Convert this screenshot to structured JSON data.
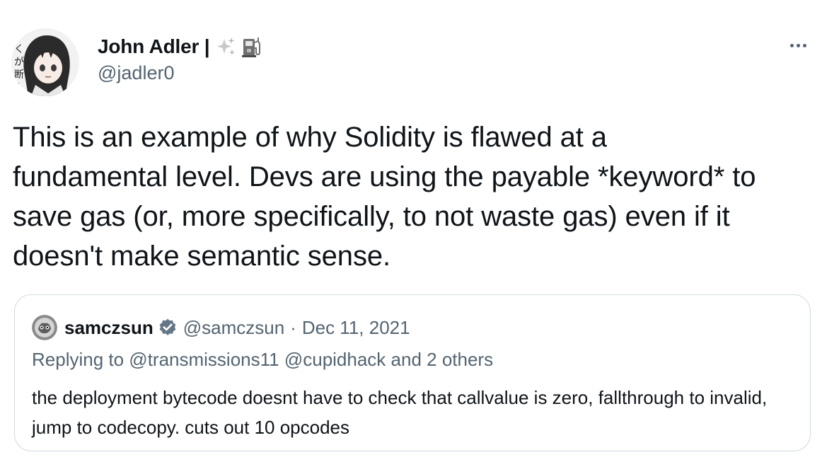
{
  "author": {
    "display_name": "John Adler |",
    "handle": "@jadler0",
    "avatar_icon": "anime-girl-avatar-icon",
    "name_emojis": [
      "sparkles-icon",
      "fuel-pump-icon"
    ]
  },
  "more_icon": "more-horizontal-icon",
  "tweet": {
    "text": "This is an example of why Solidity is flawed at a fundamental level. Devs are using the payable *keyword* to save gas (or, more specifically, to not waste gas) even if it doesn't make semantic sense."
  },
  "quote": {
    "display_name": "samczsun",
    "verified_icon": "verified-badge-icon",
    "handle": "@samczsun",
    "separator": "·",
    "date": "Dec 11, 2021",
    "replying": "Replying to @transmissions11 @cupidhack and 2 others",
    "text": "the deployment bytecode doesnt have to check that callvalue is zero, fallthrough to invalid, jump to codecopy. cuts out 10 opcodes"
  },
  "colors": {
    "primary_text": "#0f1419",
    "secondary_text": "#536471",
    "border": "#cfd9de",
    "verified": "#1d9bf0"
  }
}
